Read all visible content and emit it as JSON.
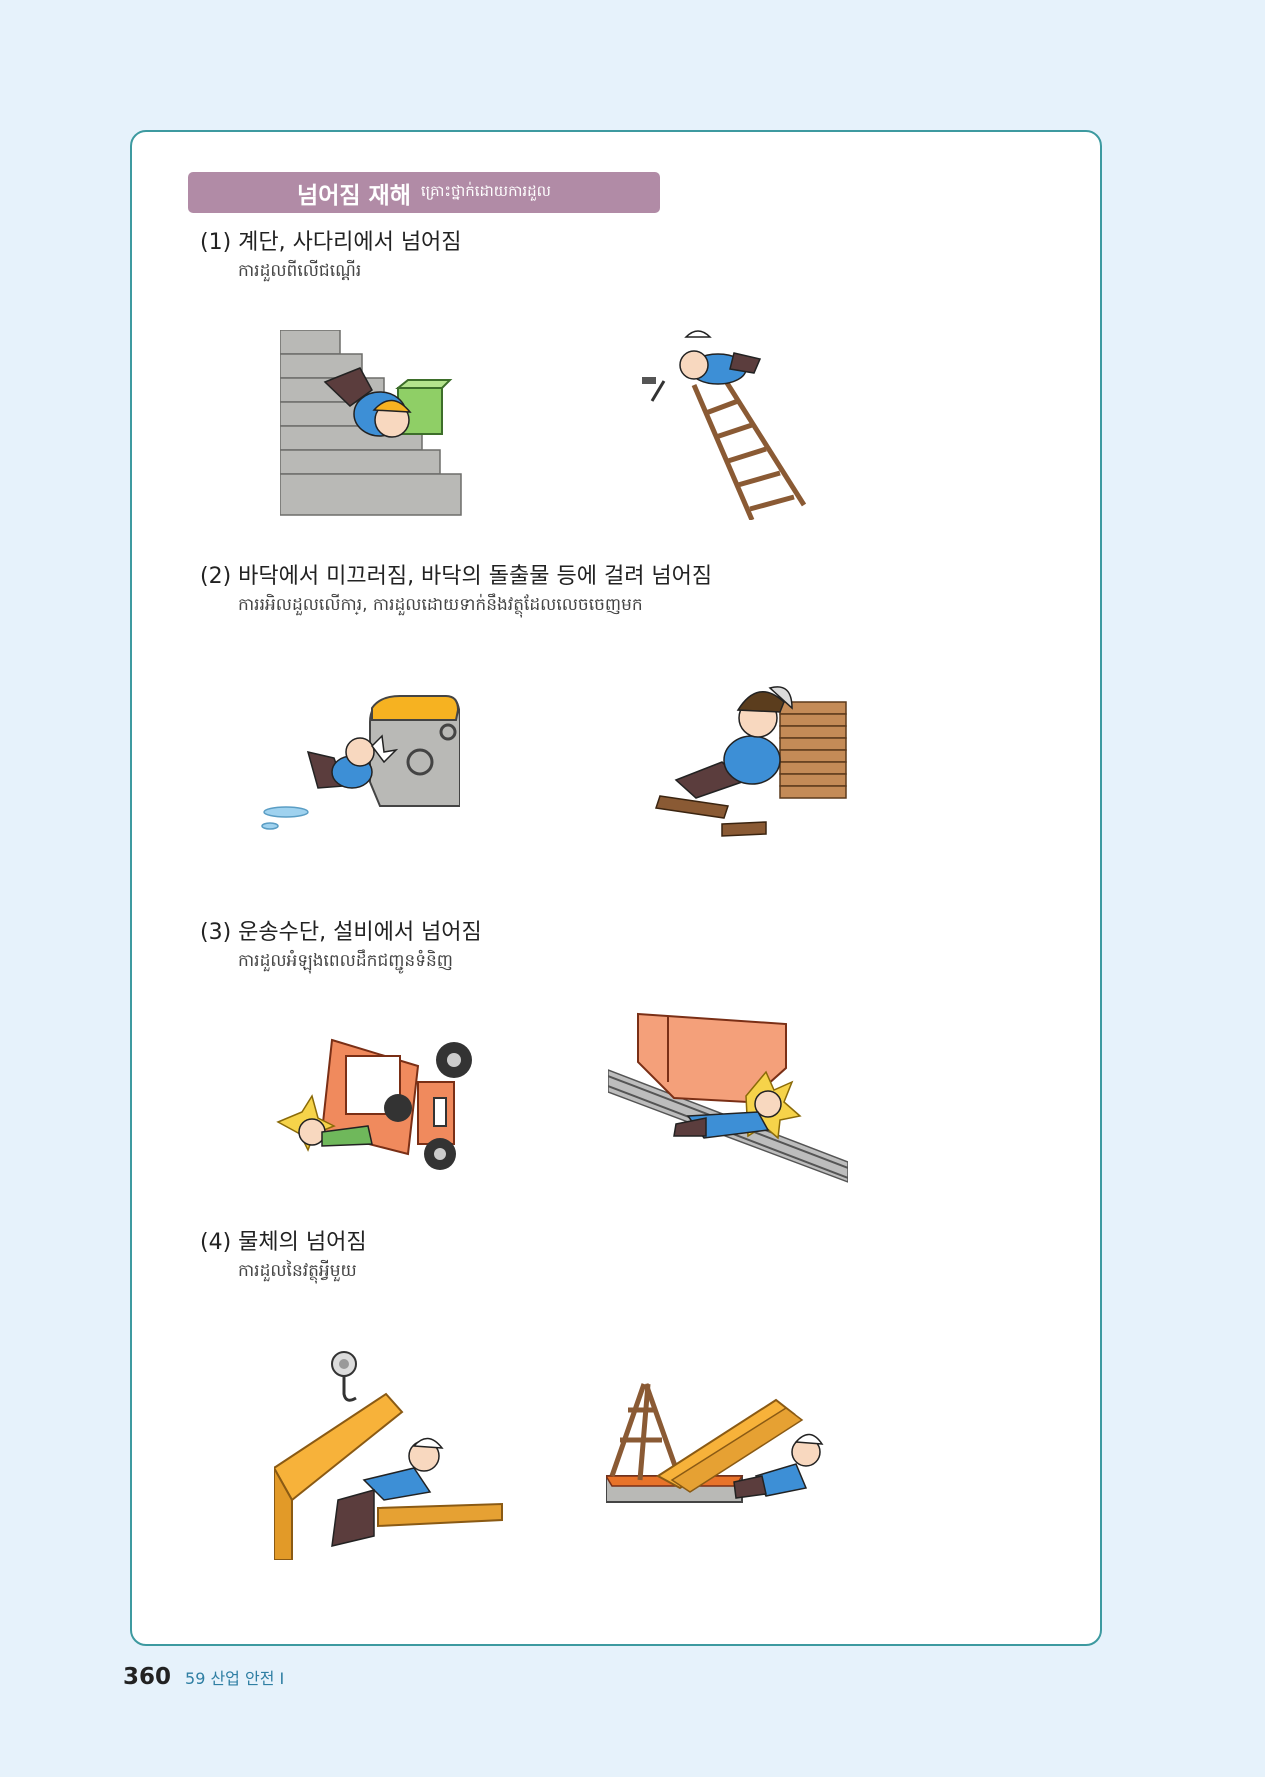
{
  "header": {
    "title_ko": "넘어짐 재해",
    "title_km": "គ្រោះថ្នាក់ដោយការដួល"
  },
  "sections": [
    {
      "title": "(1) 계단, 사다리에서 넘어짐",
      "subtitle": "ការដួលពីលើជណ្តើរ"
    },
    {
      "title": "(2) 바닥에서 미끄러짐, 바닥의 돌출물 등에 걸려 넘어짐",
      "subtitle": "ការរអិលដួលលើការ្, ការដួលដោយទាក់នឹងវត្ថុដែលលេចចេញមក"
    },
    {
      "title": "(3) 운송수단, 설비에서 넘어짐",
      "subtitle": "ការដួលអំឡុងពេលដឹកជញ្ជូនទំនិញ"
    },
    {
      "title": "(4) 물체의 넘어짐",
      "subtitle": "ការដួលនៃវត្ថុអ្វីមួយ"
    }
  ],
  "footer": {
    "page_number": "360",
    "book_title": "59 산업 안전  I"
  }
}
